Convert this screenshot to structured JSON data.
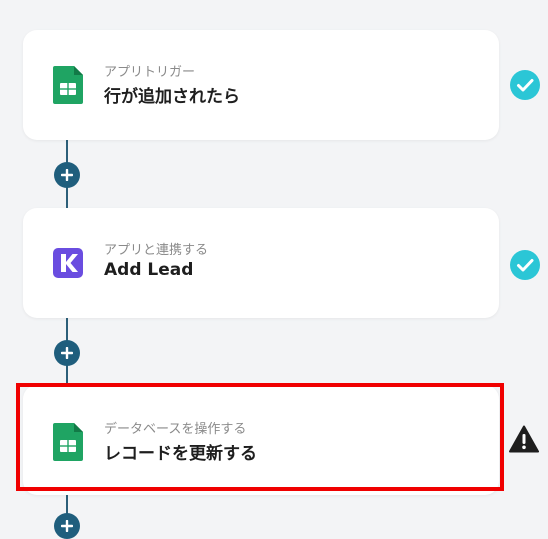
{
  "colors": {
    "connector": "#2c5f79",
    "add_button": "#1f5e7d",
    "check": "#2bc6d6",
    "sheets_green": "#1fa463",
    "kintone_purple": "#6a4de0",
    "warning": "#1e1e1e",
    "highlight": "#f00000"
  },
  "steps": [
    {
      "subtitle": "アプリトリガー",
      "title": "行が追加されたら",
      "icon": "google-sheets-icon",
      "status": "check-icon"
    },
    {
      "subtitle": "アプリと連携する",
      "title": "Add Lead",
      "icon": "app-k-logo-icon",
      "status": "check-icon"
    },
    {
      "subtitle": "データベースを操作する",
      "title": "レコードを更新する",
      "icon": "google-sheets-icon",
      "status": "warning-icon"
    }
  ],
  "add_buttons": [
    "plus-icon",
    "plus-icon",
    "plus-icon"
  ]
}
